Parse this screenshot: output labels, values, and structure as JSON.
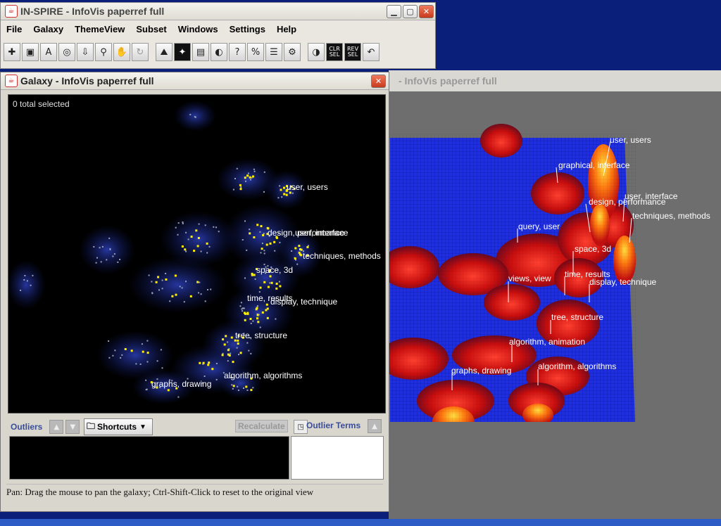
{
  "main_window": {
    "title": "IN-SPIRE - InfoVis paperref full",
    "menu": [
      "File",
      "Galaxy",
      "ThemeView",
      "Subset",
      "Windows",
      "Settings",
      "Help"
    ],
    "toolbar_icons": [
      "select-s-icon",
      "select-v-icon",
      "text-ab-icon",
      "color-c-icon",
      "down-arrow-icon",
      "zoom-icon",
      "pan-hand-icon",
      "rotate-icon",
      "themeview-icon",
      "galaxy-stars-icon",
      "document-icon",
      "toggle-icon",
      "query-icon",
      "percent-icon",
      "list-icon",
      "tool-icon",
      "contrast-icon",
      "clear-select-icon",
      "reverse-select-icon",
      "undo-icon"
    ],
    "tool_clr_sel": "CLR SEL",
    "tool_rev_sel": "REV SEL",
    "tool_percent": "%"
  },
  "galaxy_window": {
    "title": "Galaxy - InfoVis paperref full",
    "selected_count": "0 total selected",
    "labels": [
      "user, users",
      "design, performance",
      "user, interface",
      "techniques, methods",
      "space, 3d",
      "time, results",
      "display, technique",
      "tree, structure",
      "algorithm, algorithms",
      "graphs, drawing"
    ],
    "outliers_label": "Outliers",
    "shortcuts_label": "Shortcuts",
    "recalculate_label": "Recalculate",
    "outlier_terms_label": "Outlier Terms",
    "status": "Pan: Drag the mouse to pan the galaxy; Ctrl-Shift-Click to reset to the original view"
  },
  "theme_window": {
    "title": "- InfoVis paperref full",
    "labels": [
      "user, users",
      "graphical, interface",
      "user, interface",
      "design, performance",
      "techniques, methods",
      "query, user",
      "space, 3d",
      "views, view",
      "time, results",
      "display, technique",
      "tree, structure",
      "algorithm, animation",
      "graphs, drawing",
      "algorithm, algorithms"
    ]
  },
  "colors": {
    "desktop": "#0a1f7a",
    "theme_plane": "#1f2fe0",
    "peak_red": "#d01010",
    "peak_yellow": "#ffd020",
    "point_yellow": "#ffef00"
  }
}
